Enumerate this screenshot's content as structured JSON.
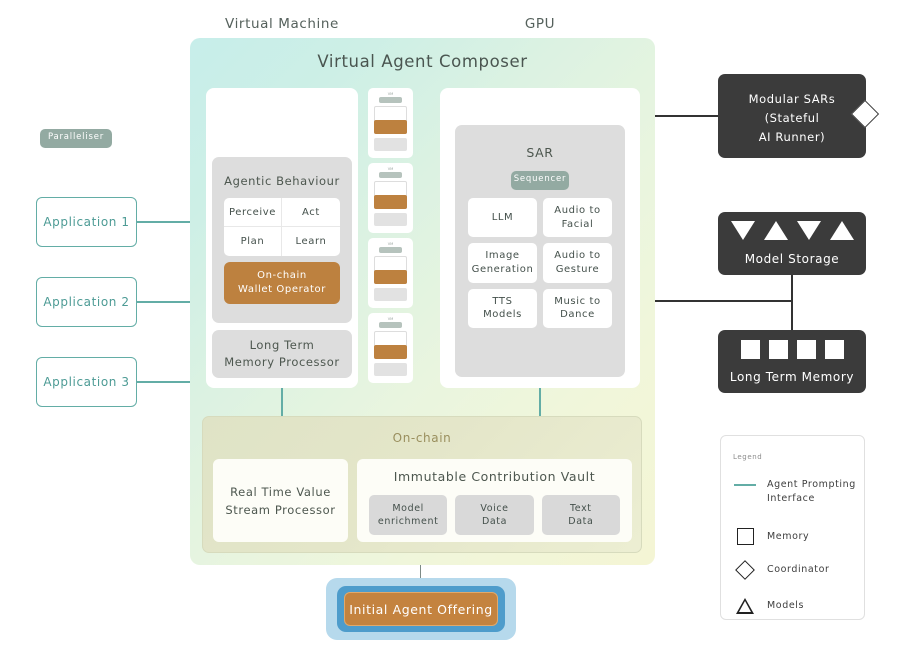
{
  "diagram": {
    "title": "Virtual Agent Composer"
  },
  "virtual_machine": {
    "title": "Virtual Machine",
    "badge": "Paralleliser",
    "agentic": {
      "title": "Agentic Behaviour",
      "cells": [
        "Perceive",
        "Act",
        "Plan",
        "Learn"
      ]
    },
    "wallet": {
      "line1": "On-chain",
      "line2": "Wallet Operator"
    },
    "memory_processor": {
      "line1": "Long Term",
      "line2": "Memory Processor"
    },
    "mini_label": "VM"
  },
  "gpu": {
    "title": "GPU",
    "sar_title": "SAR",
    "badge": "Sequencer",
    "models": [
      {
        "line1": "LLM",
        "line2": ""
      },
      {
        "line1": "Audio to",
        "line2": "Facial"
      },
      {
        "line1": "Image",
        "line2": "Generation"
      },
      {
        "line1": "Audio to",
        "line2": "Gesture"
      },
      {
        "line1": "TTS",
        "line2": "Models"
      },
      {
        "line1": "Music to",
        "line2": "Dance"
      }
    ]
  },
  "onchain": {
    "title": "On-chain",
    "stream_processor": {
      "line1": "Real Time Value",
      "line2": "Stream Processor"
    },
    "vault_title": "Immutable Contribution Vault",
    "vault_items": [
      {
        "line1": "Model",
        "line2": "enrichment"
      },
      {
        "line1": "Voice",
        "line2": "Data"
      },
      {
        "line1": "Text",
        "line2": "Data"
      }
    ]
  },
  "applications": [
    {
      "label": "Application 1"
    },
    {
      "label": "Application 2"
    },
    {
      "label": "Application 3"
    }
  ],
  "right_nodes": {
    "modular_sars": {
      "line1": "Modular SARs",
      "line2": "(Stateful",
      "line3": "AI Runner)"
    },
    "model_storage": {
      "label": "Model Storage"
    },
    "long_term_memory": {
      "label": "Long Term Memory"
    }
  },
  "offering": {
    "label": "Initial Agent Offering"
  },
  "legend": {
    "title": "Legend",
    "items": [
      {
        "icon": "line-icon",
        "label": "Agent Prompting Interface"
      },
      {
        "icon": "square-icon",
        "label": "Memory"
      },
      {
        "icon": "diamond-icon",
        "label": "Coordinator"
      },
      {
        "icon": "triangle-icon",
        "label": "Models"
      }
    ]
  },
  "colors": {
    "teal": "#63ada6",
    "orange": "#bd813f",
    "sage": "#93aaa2",
    "dark": "#3b3b3b",
    "blue": "#4e9ccb",
    "blue_light": "#b6d9ec",
    "olive": "#9a8f5e"
  }
}
